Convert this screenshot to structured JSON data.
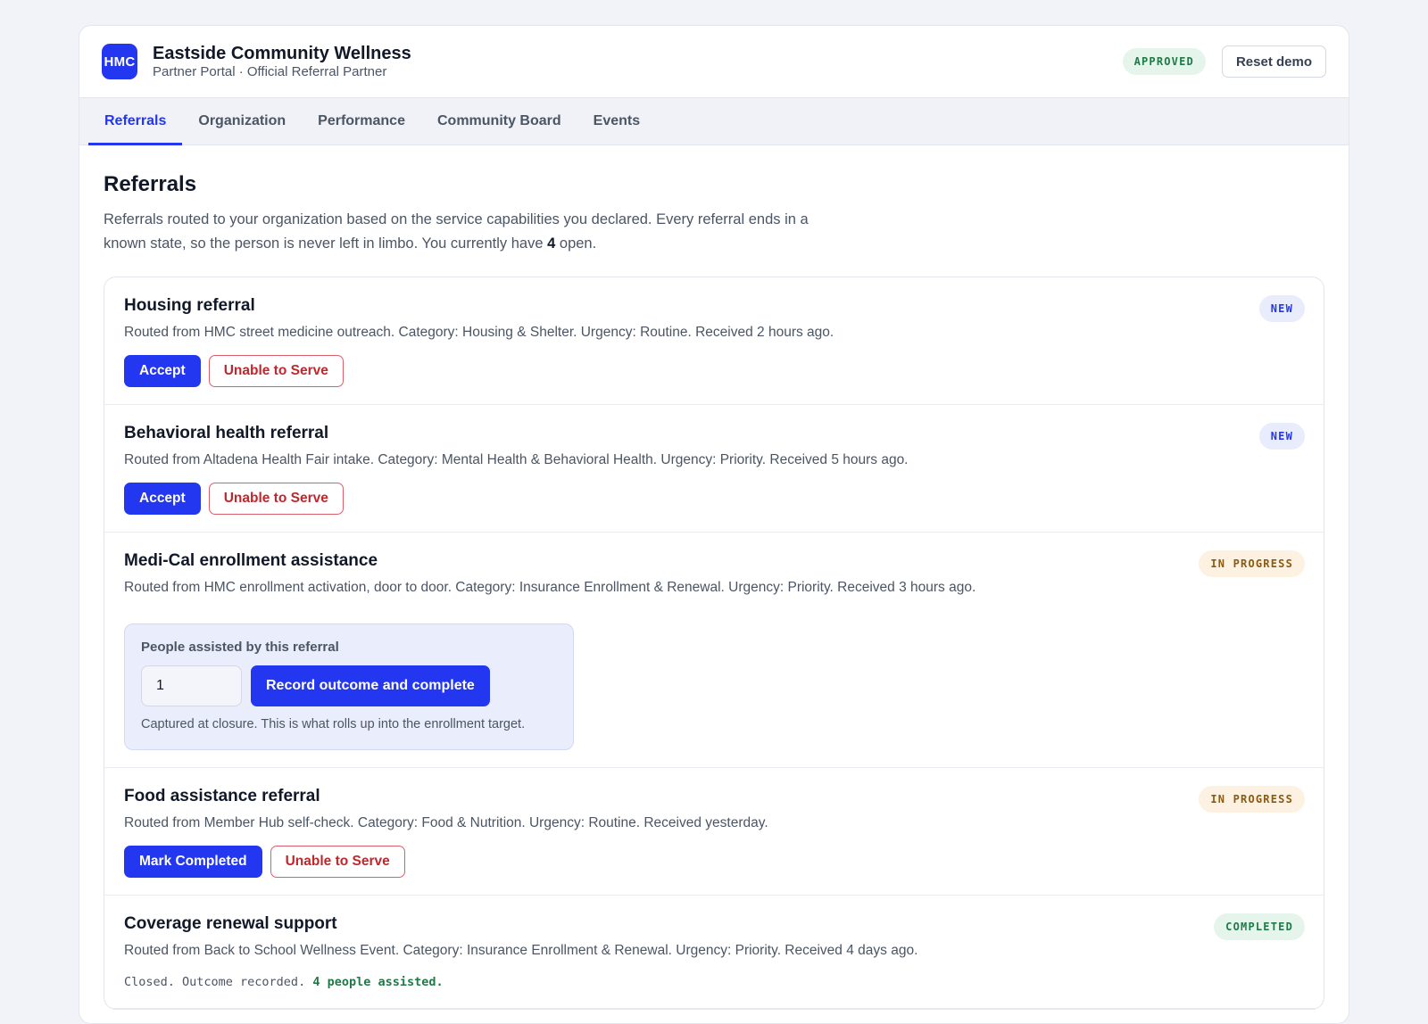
{
  "app": {
    "logo_text": "HMC",
    "org_name": "Eastside Community Wellness",
    "org_subtitle": "Partner Portal · Official Referral Partner",
    "status_badge": "APPROVED",
    "reset_label": "Reset demo"
  },
  "tabs": [
    {
      "label": "Referrals",
      "active": true
    },
    {
      "label": "Organization",
      "active": false
    },
    {
      "label": "Performance",
      "active": false
    },
    {
      "label": "Community Board",
      "active": false
    },
    {
      "label": "Events",
      "active": false
    }
  ],
  "page": {
    "title": "Referrals",
    "desc_before": "Referrals routed to your organization based on the service capabilities you declared. Every referral ends in a known state, so the person is never left in limbo. You currently have ",
    "open_count": "4",
    "desc_after": " open."
  },
  "referrals": [
    {
      "title": "Housing referral",
      "status": "NEW",
      "description": "Routed from HMC street medicine outreach. Category: Housing & Shelter. Urgency: Routine. Received 2 hours ago.",
      "primary_action": "Accept",
      "secondary_action": "Unable to Serve"
    },
    {
      "title": "Behavioral health referral",
      "status": "NEW",
      "description": "Routed from Altadena Health Fair intake. Category: Mental Health & Behavioral Health. Urgency: Priority. Received 5 hours ago.",
      "primary_action": "Accept",
      "secondary_action": "Unable to Serve"
    },
    {
      "title": "Medi-Cal enrollment assistance",
      "status": "IN PROGRESS",
      "description": "Routed from HMC enrollment activation, door to door. Category: Insurance Enrollment & Renewal. Urgency: Priority. Received 3 hours ago.",
      "outcome": {
        "label": "People assisted by this referral",
        "value": "1",
        "submit_label": "Record outcome and complete",
        "note": "Captured at closure. This is what rolls up into the enrollment target."
      }
    },
    {
      "title": "Food assistance referral",
      "status": "IN PROGRESS",
      "description": "Routed from Member Hub self-check. Category: Food & Nutrition. Urgency: Routine. Received yesterday.",
      "primary_action": "Mark Completed",
      "secondary_action": "Unable to Serve"
    },
    {
      "title": "Coverage renewal support",
      "status": "COMPLETED",
      "description": "Routed from Back to School Wellness Event. Category: Insurance Enrollment & Renewal. Urgency: Priority. Received 4 days ago.",
      "closed_text": "Closed. Outcome recorded. ",
      "closed_highlight": "4 people assisted."
    }
  ],
  "colors": {
    "accent": "#2437f0",
    "danger": "#c0272d",
    "success": "#1f7a47",
    "warning": "#8a5a12"
  }
}
